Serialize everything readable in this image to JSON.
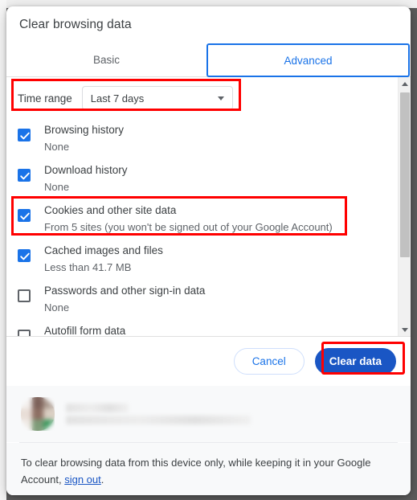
{
  "dialog": {
    "title": "Clear browsing data",
    "tabs": [
      {
        "label": "Basic",
        "active": false
      },
      {
        "label": "Advanced",
        "active": true
      }
    ],
    "time_range": {
      "label": "Time range",
      "selected": "Last 7 days",
      "caret_icon": "chevron-down-icon"
    },
    "items": [
      {
        "title": "Browsing history",
        "subtitle": "None",
        "checked": true
      },
      {
        "title": "Download history",
        "subtitle": "None",
        "checked": true
      },
      {
        "title": "Cookies and other site data",
        "subtitle": "From 5 sites (you won't be signed out of your Google Account)",
        "checked": true
      },
      {
        "title": "Cached images and files",
        "subtitle": "Less than 41.7 MB",
        "checked": true
      },
      {
        "title": "Passwords and other sign-in data",
        "subtitle": "None",
        "checked": false
      },
      {
        "title": "Autofill form data",
        "subtitle": "",
        "checked": false
      }
    ],
    "actions": {
      "cancel_label": "Cancel",
      "clear_label": "Clear data"
    },
    "footer": {
      "note_prefix": "To clear browsing data from this device only, while keeping it in your Google Account, ",
      "sign_out_link": "sign out",
      "note_suffix": "."
    },
    "scrollbar": {
      "up_icon": "scroll-up-arrow-icon",
      "down_icon": "scroll-down-arrow-icon"
    }
  },
  "colors": {
    "accent_blue": "#1a73e8",
    "button_blue": "#1a56c4",
    "annotation_red": "#ff0000",
    "text_primary": "#3c4043",
    "text_secondary": "#5f6368",
    "footer_bg": "#f8f9fa"
  }
}
